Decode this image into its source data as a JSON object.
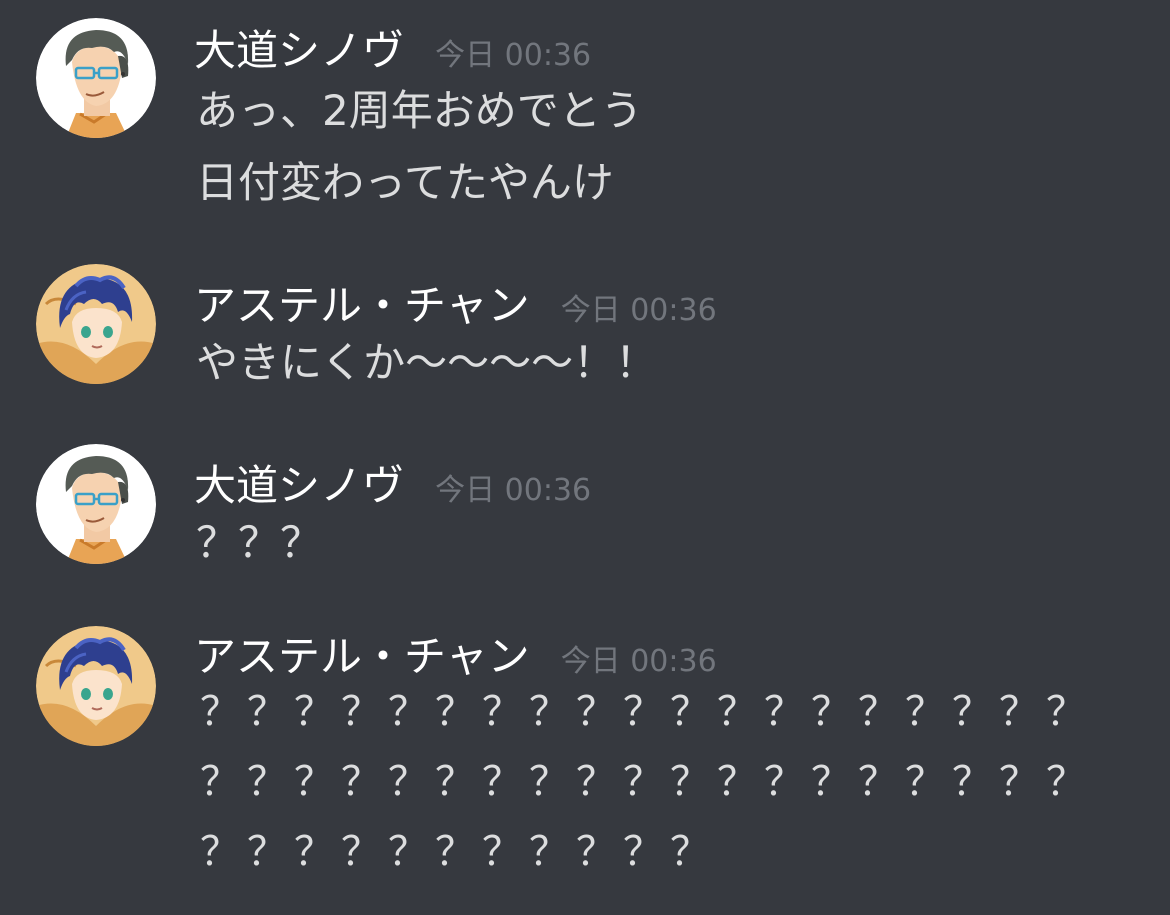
{
  "colors": {
    "background": "#36393f",
    "username": "#ffffff",
    "timestamp": "#72767d",
    "message_text": "#dcddde"
  },
  "messages": [
    {
      "username": "大道シノヴ",
      "timestamp": "今日 00:36",
      "avatar_icon": "glasses-man-avatar-icon",
      "lines": [
        "あっ、2周年おめでとう",
        "日付変わってたやんけ"
      ]
    },
    {
      "username": "アステル・チャン",
      "timestamp": "今日 00:36",
      "avatar_icon": "blue-hair-boy-avatar-icon",
      "lines": [
        "やきにくか〜〜〜〜！！"
      ]
    },
    {
      "username": "大道シノヴ",
      "timestamp": "今日 00:36",
      "avatar_icon": "glasses-man-avatar-icon",
      "lines": [
        "？？？"
      ]
    },
    {
      "username": "アステル・チャン",
      "timestamp": "今日 00:36",
      "avatar_icon": "blue-hair-boy-avatar-icon",
      "lines": [
        "？？？？？？？？？？？？？？？？？？？",
        "？？？？？？？？？？？？？？？？？？？",
        "？？？？？？？？？？？"
      ]
    }
  ]
}
